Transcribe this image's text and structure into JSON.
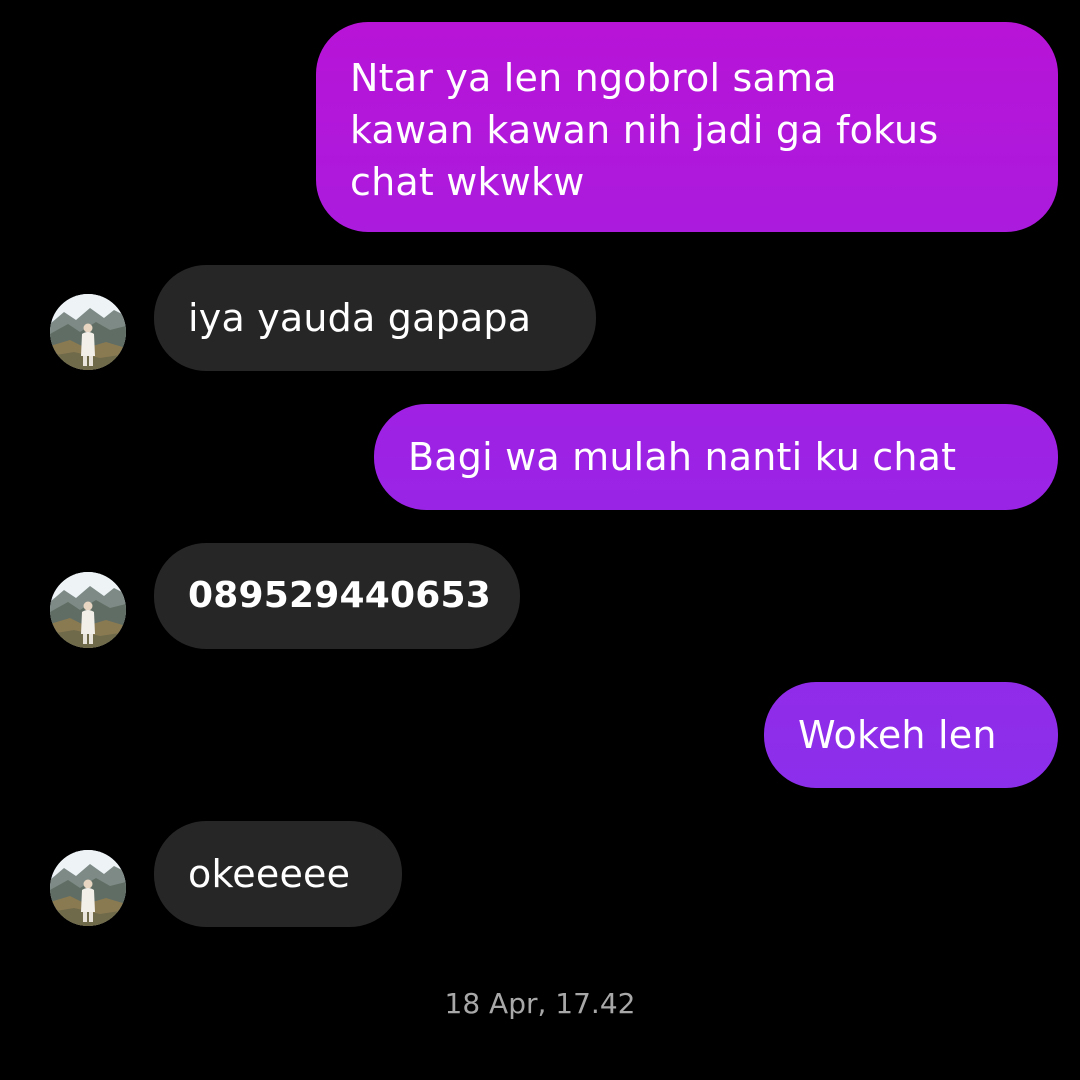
{
  "messages": [
    {
      "id": "m1",
      "direction": "sent",
      "text": "Ntar ya len ngobrol sama\nkawan kawan nih jadi ga fokus\nchat wkwkw"
    },
    {
      "id": "m2",
      "direction": "received",
      "text": "iya yauda gapapa"
    },
    {
      "id": "m3",
      "direction": "sent",
      "text": "Bagi wa mulah nanti ku chat"
    },
    {
      "id": "m4",
      "direction": "received",
      "text": "089529440653"
    },
    {
      "id": "m5",
      "direction": "sent",
      "text": "Wokeh len"
    },
    {
      "id": "m6",
      "direction": "received",
      "text": "okeeeee"
    }
  ],
  "timestamp": "18 Apr, 17.42",
  "colors": {
    "background": "#000000",
    "sent_gradient_top": "#b913d6",
    "sent_gradient_mid": "#9a24e6",
    "sent_gradient_bottom": "#7c3af0",
    "received_bubble": "#262626",
    "text": "#ffffff",
    "timestamp_text": "#a8a8a8"
  },
  "icons": {
    "avatar": "contact-avatar-photo-icon"
  }
}
